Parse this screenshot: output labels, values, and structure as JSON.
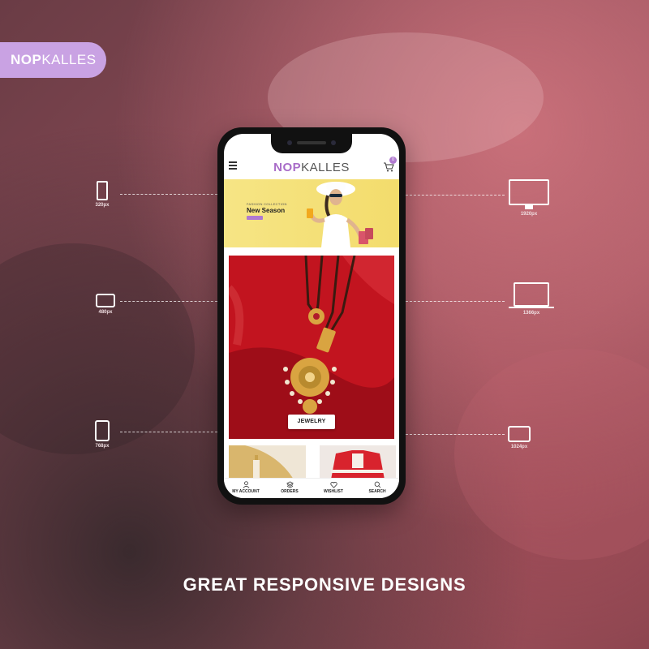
{
  "brand": {
    "bold": "NOP",
    "light": "KALLES"
  },
  "devices": [
    {
      "id": "phone-320",
      "label": "320px",
      "icon": "smartphone-icon"
    },
    {
      "id": "tablet-480",
      "label": "480px",
      "icon": "tablet-landscape-icon"
    },
    {
      "id": "tablet-768",
      "label": "768px",
      "icon": "tablet-portrait-icon"
    },
    {
      "id": "desktop-1920",
      "label": "1920px",
      "icon": "desktop-monitor-icon"
    },
    {
      "id": "laptop-1366",
      "label": "1366px",
      "icon": "laptop-icon"
    },
    {
      "id": "tablet-1024",
      "label": "1024px",
      "icon": "tablet-landscape-icon"
    }
  ],
  "app": {
    "logo_bold": "NOP",
    "logo_light": "KALLES",
    "cart_count": "0",
    "hero": {
      "small": "FASHION COLLECTION",
      "title": "New Season"
    },
    "jewel_button": "JEWELRY",
    "nav": [
      {
        "label": "MY ACCOUNT",
        "icon": "user-icon"
      },
      {
        "label": "ORDERS",
        "icon": "layers-icon"
      },
      {
        "label": "WISHLIST",
        "icon": "heart-icon"
      },
      {
        "label": "SEARCH",
        "icon": "search-icon"
      }
    ]
  },
  "footer_title": "GREAT RESPONSIVE DESIGNS",
  "colors": {
    "accent": "#c9a2e3",
    "logo_purple": "#a86cc8",
    "jewel_red": "#b8101e",
    "hero_yellow": "#f3dc6c"
  }
}
